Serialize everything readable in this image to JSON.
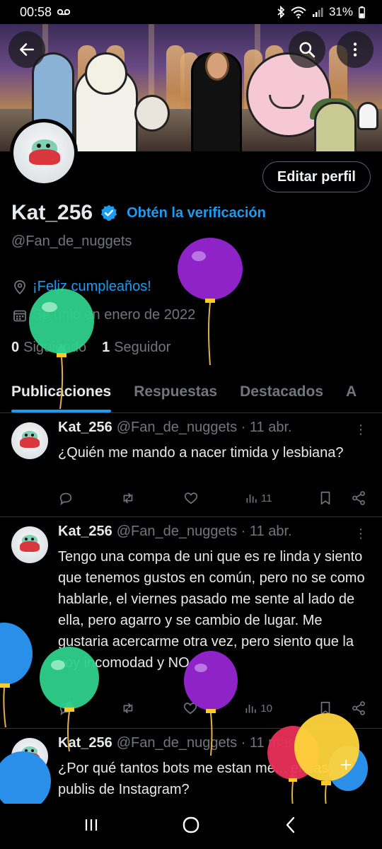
{
  "status_bar": {
    "time": "00:58",
    "battery": "31%"
  },
  "profile": {
    "display_name": "Kat_256",
    "get_verified": "Obtén la verificación",
    "handle": "@Fan_de_nuggets",
    "edit_button": "Editar perfil",
    "birthday": "¡Feliz cumpleaños!",
    "joined": "Se unió en enero de 2022",
    "following_count": "0",
    "following_label": "Siguiendo",
    "followers_count": "1",
    "followers_label": "Seguidor"
  },
  "tabs": [
    "Publicaciones",
    "Respuestas",
    "Destacados",
    "A"
  ],
  "tweets": [
    {
      "name": "Kat_256",
      "handle": "@Fan_de_nuggets · 11 abr.",
      "text": "¿Quién me mando a nacer timida y lesbiana?",
      "views": "11"
    },
    {
      "name": "Kat_256",
      "handle": "@Fan_de_nuggets · 11 abr.",
      "text": "Tengo una compa de uni que es re linda y siento que tenemos gustos en común, pero no se como hablarle, el viernes pasado me sente al lado de ella, pero agarro y se cambio de lugar. Me gustaria acercarme otra vez, pero siento que la voy incomodad y NO DA.",
      "views": "10"
    },
    {
      "name": "Kat_256",
      "handle": "@Fan_de_nuggets · 11 mar.",
      "text": "¿Por qué tantos bots me estan me... en las publis de Instagram?"
    }
  ],
  "colors": {
    "accent": "#1d9bf0",
    "background": "#000000",
    "muted": "#71767b"
  }
}
